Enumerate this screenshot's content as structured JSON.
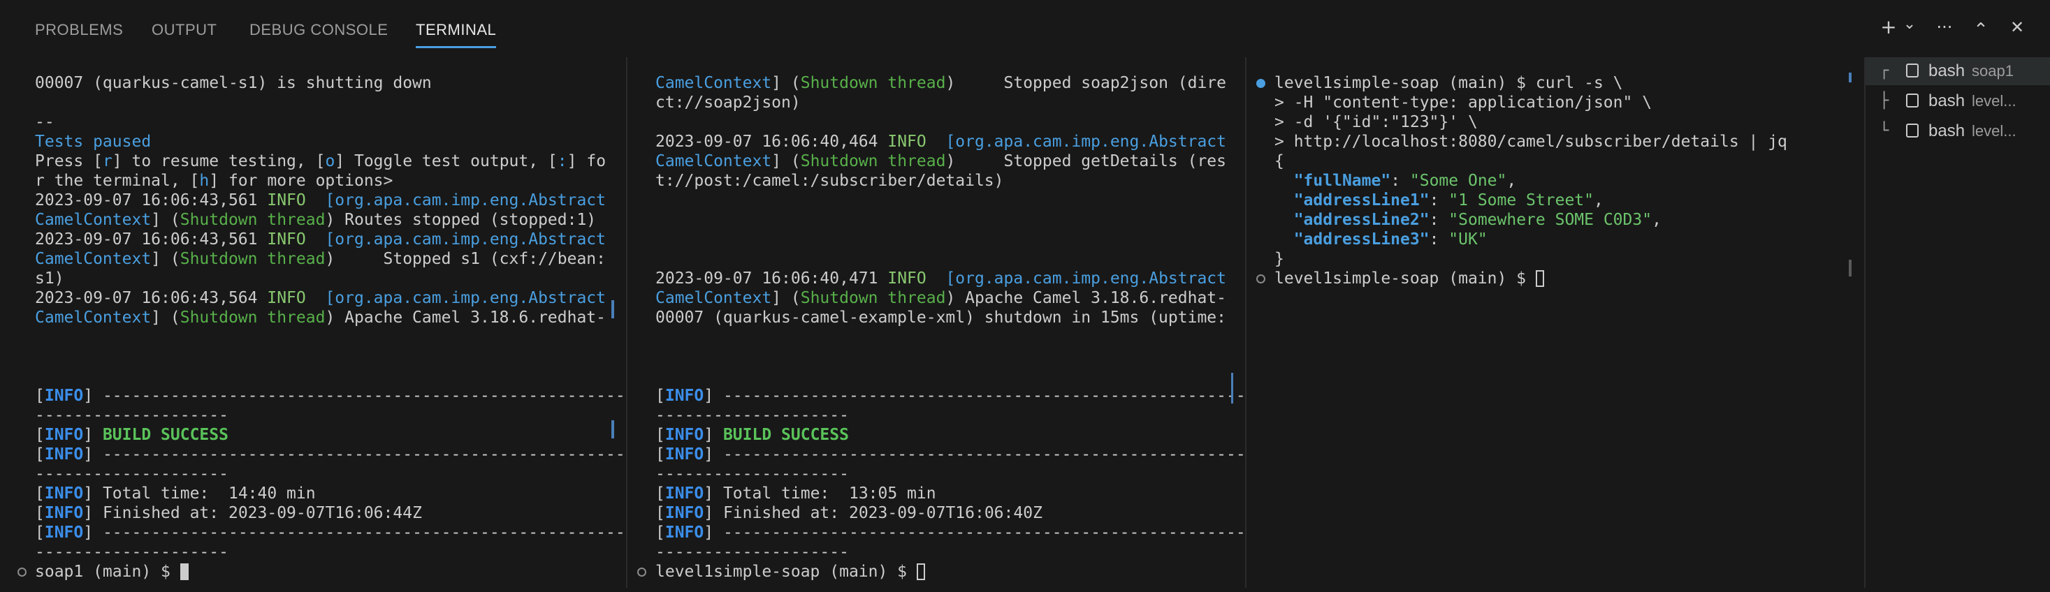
{
  "tabs": [
    {
      "label": "PROBLEMS"
    },
    {
      "label": "OUTPUT"
    },
    {
      "label": "DEBUG CONSOLE"
    },
    {
      "label": "TERMINAL"
    }
  ],
  "toolbar": {
    "new_terminal_icon": "+",
    "dropdown_icon": "⌄",
    "more_icon": "···",
    "maximize_icon": "⌃",
    "close_icon": "✕"
  },
  "pane1": {
    "l1": "00007 (quarkus-camel-s1) is shutting down",
    "l2": "--",
    "l3": "Tests paused",
    "l4a": "Press [",
    "l4b": "r",
    "l4c": "] to resume testing, [",
    "l4d": "o",
    "l4e": "] Toggle test output, [",
    "l4f": ":",
    "l4g": "] fo",
    "l5a": "r the terminal, [",
    "l5b": "h",
    "l5c": "] for more options>",
    "ts1": "2023-09-07 16:06:43,561 ",
    "info": "INFO",
    "cls1": "[org.apa.cam.imp.eng.Abstract",
    "cls2": "CamelContext",
    "thread": "Shutdown thread",
    "msg1": "] (",
    "msg1b": ") Routes stopped (stopped:1)",
    "ts2": "2023-09-07 16:06:43,561 ",
    "msg2b": ")     Stopped s1 (cxf://bean:",
    "l11": "s1)",
    "ts3": "2023-09-07 16:06:43,564 ",
    "msg3b": ") Apache Camel 3.18.6.redhat-",
    "info_tag": "INFO",
    "dashes": "----------------------------------------------------------------------",
    "dashes2": "--------------------",
    "build": "BUILD SUCCESS",
    "total": "Total time:  14:40 min",
    "finished": "Finished at: 2023-09-07T16:06:44Z",
    "prompt": "soap1 (main) $ "
  },
  "pane2": {
    "l1a": "CamelContext",
    "l1b": "] (",
    "l1c": "Shutdown thread",
    "l1d": ")     Stopped soap2json (dire",
    "l2": "ct://soap2json)",
    "ts1": "2023-09-07 16:06:40,464 ",
    "cls": "[org.apa.cam.imp.eng.Abstract",
    "l3d": ")     Stopped getDetails (res",
    "l4": "t://post:/camel:/subscriber/details)",
    "ts2": "2023-09-07 16:06:40,471 ",
    "l6d": ") Apache Camel 3.18.6.redhat-",
    "l7": "00007 (quarkus-camel-example-xml) shutdown in 15ms (uptime:",
    "total": "Total time:  13:05 min",
    "finished": "Finished at: 2023-09-07T16:06:40Z",
    "prompt": "level1simple-soap (main) $ "
  },
  "pane3": {
    "l1": "level1simple-soap (main) $ curl -s \\",
    "l2": "> -H \"content-type: application/json\" \\",
    "l3": "> -d '{\"id\":\"123\"}' \\",
    "l4": "> http://localhost:8080/camel/subscriber/details | jq",
    "open": "{",
    "k1": "\"fullName\"",
    "v1": "\"Some One\"",
    "k2": "\"addressLine1\"",
    "v2": "\"1 Some Street\"",
    "k3": "\"addressLine2\"",
    "v3": "\"Somewhere SOME C0D3\"",
    "k4": "\"addressLine3\"",
    "v4": "\"UK\"",
    "colon": ": ",
    "comma": ",",
    "close": "}",
    "prompt": "level1simple-soap (main) $ "
  },
  "terminal_list": [
    {
      "tree": "┌",
      "name": "bash",
      "sub": "soap1"
    },
    {
      "tree": "├",
      "name": "bash",
      "sub": "level..."
    },
    {
      "tree": "└",
      "name": "bash",
      "sub": "level..."
    }
  ]
}
